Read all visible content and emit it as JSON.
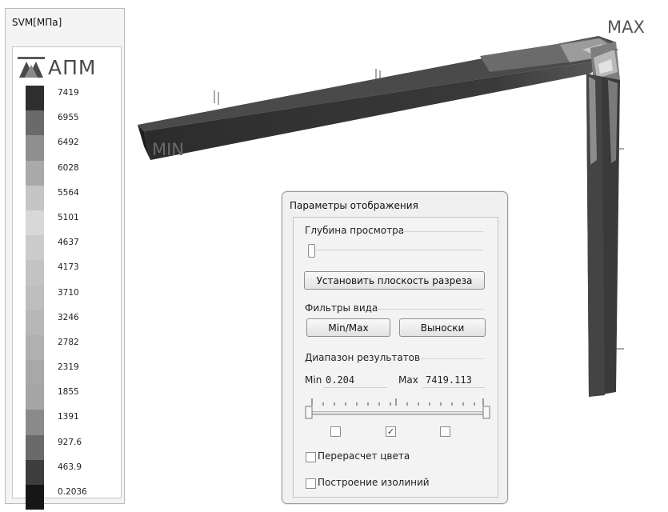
{
  "legend": {
    "title": "SVM[МПа]",
    "logo_text": "АПМ",
    "scale_colors": [
      "#2e2e2e",
      "#6a6a6a",
      "#8f8f8f",
      "#a9a9a9",
      "#c5c5c5",
      "#d8d8d8",
      "#cbcbcb",
      "#c3c3c3",
      "#bebebe",
      "#b7b7b7",
      "#b0b0b0",
      "#a8a8a8",
      "#a5a5a5",
      "#8a8a8a",
      "#6a6a6a",
      "#3d3d3d",
      "#161616"
    ],
    "labels": [
      "7419",
      "6955",
      "6492",
      "6028",
      "5564",
      "5101",
      "4637",
      "4173",
      "3710",
      "3246",
      "2782",
      "2319",
      "1855",
      "1391",
      "927.6",
      "463.9",
      "0.2036"
    ]
  },
  "viewport": {
    "max_label": "MAX",
    "min_label": "MIN"
  },
  "dialog": {
    "title": "Параметры отображения",
    "depth_group": "Глубина просмотра",
    "depth_value": 0,
    "cut_plane_button": "Установить плоскость разреза",
    "filters_group": "Фильтры вида",
    "minmax_button": "Min/Max",
    "callouts_button": "Выноски",
    "range_group": "Диапазон результатов",
    "min_label": "Min",
    "min_value": "0.204",
    "max_label": "Max",
    "max_value": "7419.113",
    "range_checks": [
      false,
      true,
      false
    ],
    "recalc_color_label": "Перерасчет цвета",
    "recalc_color_checked": false,
    "isolines_label": "Построение изолиний",
    "isolines_checked": false
  }
}
